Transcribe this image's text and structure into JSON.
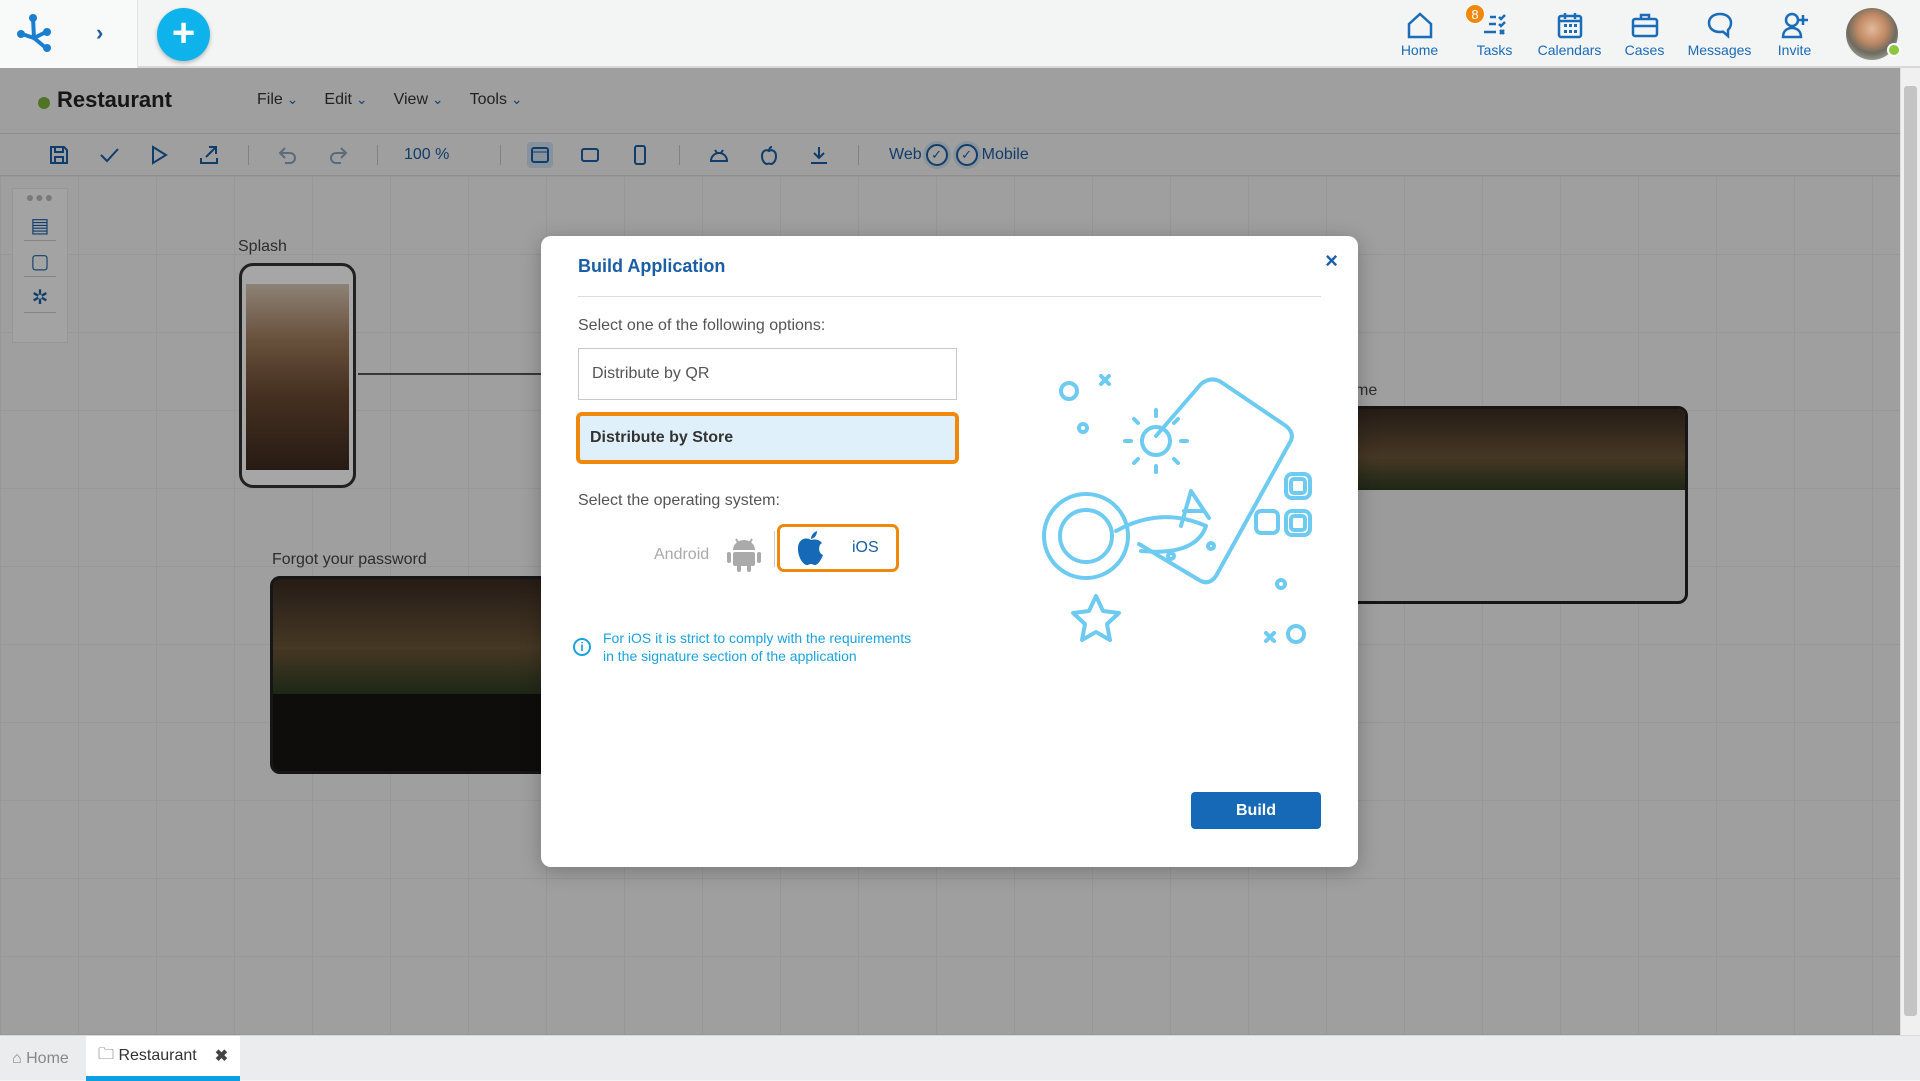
{
  "topbar": {
    "nav": [
      {
        "label": "Home",
        "icon": "home-icon"
      },
      {
        "label": "Tasks",
        "icon": "tasks-icon",
        "badge": "8"
      },
      {
        "label": "Calendars",
        "icon": "calendar-icon"
      },
      {
        "label": "Cases",
        "icon": "briefcase-icon"
      },
      {
        "label": "Messages",
        "icon": "message-icon"
      },
      {
        "label": "Invite",
        "icon": "invite-user-icon"
      }
    ],
    "add_label": "+",
    "expand_label": "›"
  },
  "project": {
    "title": "Restaurant",
    "menus": [
      "File",
      "Edit",
      "View",
      "Tools"
    ]
  },
  "toolbar": {
    "zoom": "100 %",
    "web_label": "Web",
    "mobile_label": "Mobile"
  },
  "canvas": {
    "nodes": [
      "Splash",
      "Forgot your password",
      "me"
    ]
  },
  "modal": {
    "title": "Build Application",
    "close": "×",
    "options_label": "Select one of the following options:",
    "options": [
      {
        "label": "Distribute by QR",
        "selected": false
      },
      {
        "label": "Distribute by Store",
        "selected": true
      }
    ],
    "os_label": "Select the operating system:",
    "os": [
      {
        "label": "Android",
        "selected": false
      },
      {
        "label": "iOS",
        "selected": true
      }
    ],
    "info_line1": "For iOS it is strict to comply with the requirements",
    "info_line2": "in the signature section of the application",
    "build_label": "Build"
  },
  "bottom_tabs": [
    {
      "label": "Home",
      "icon": "home-icon"
    },
    {
      "label": "Restaurant",
      "icon": "folder-icon",
      "close": "✖",
      "active": true
    }
  ],
  "colors": {
    "accent": "#1a5ea5",
    "highlight": "#f0880b",
    "fab": "#0db3ea",
    "info": "#1ba3df"
  }
}
